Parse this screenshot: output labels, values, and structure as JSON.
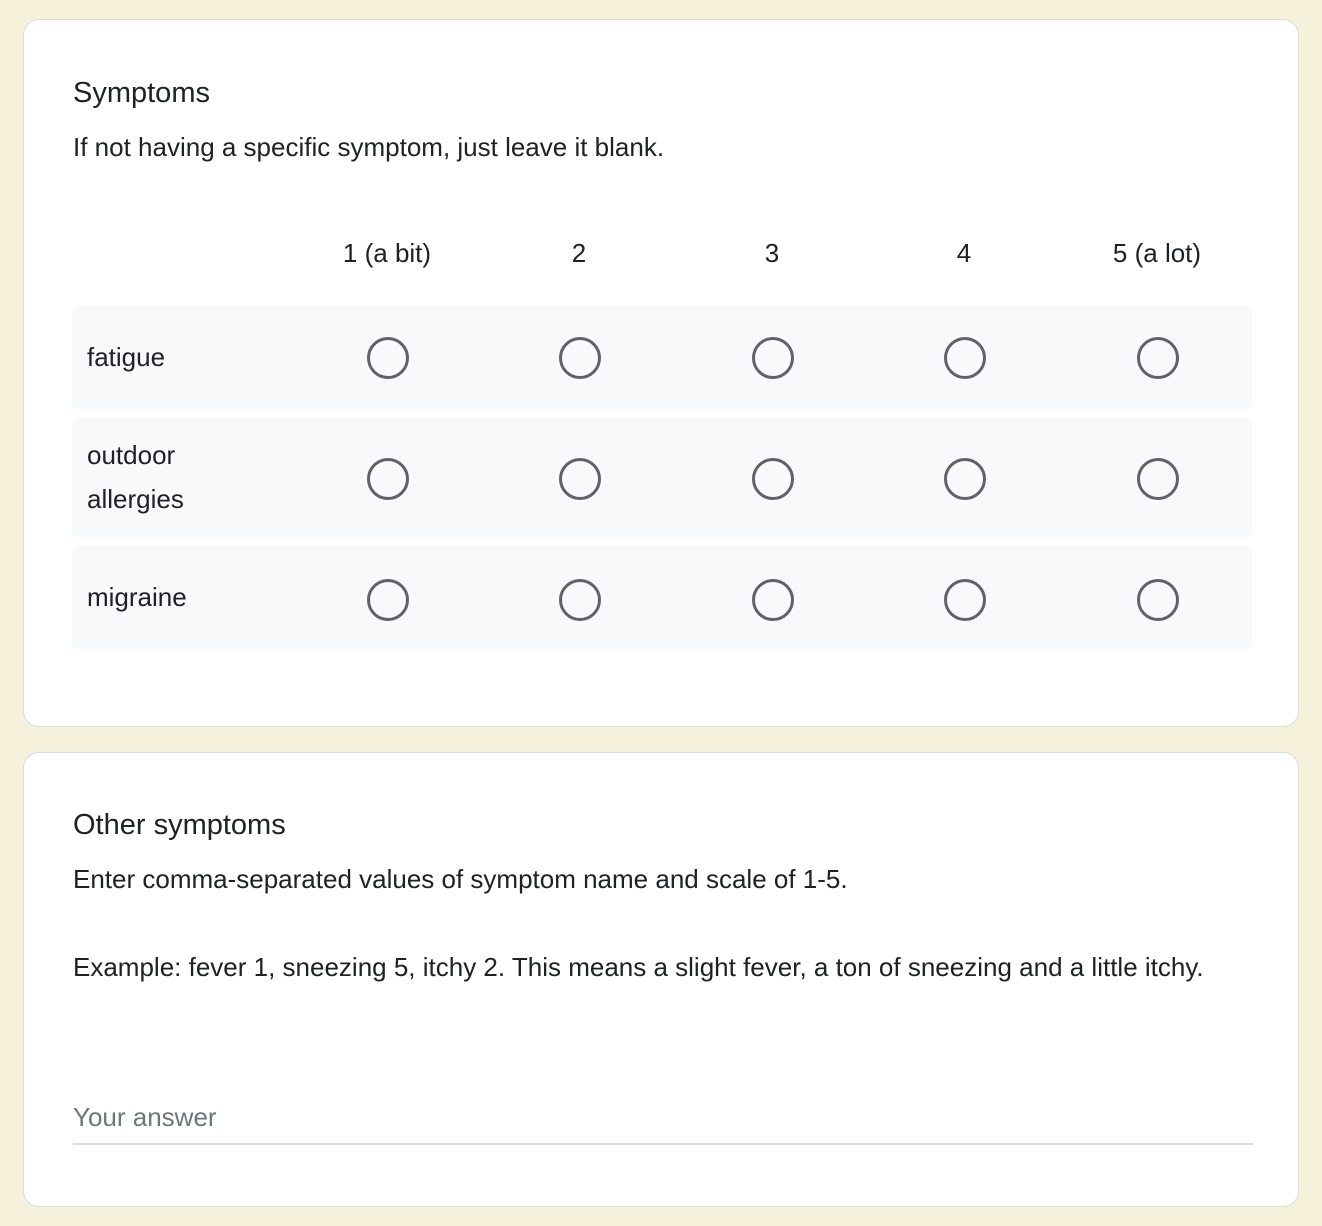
{
  "symptoms_question": {
    "title": "Symptoms",
    "description": "If not having a specific symptom, just leave it blank.",
    "columns": [
      "1 (a bit)",
      "2",
      "3",
      "4",
      "5 (a lot)"
    ],
    "rows": [
      {
        "label": "fatigue"
      },
      {
        "label": "outdoor allergies"
      },
      {
        "label": "migraine"
      }
    ]
  },
  "other_question": {
    "title": "Other symptoms",
    "description_line1": "Enter comma-separated values of symptom name and scale of 1-5.",
    "description_line2": "Example: fever 1, sneezing 5, itchy 2. This means a slight fever, a ton of sneezing and a little itchy.",
    "answer_placeholder": "Your answer",
    "answer_value": ""
  }
}
